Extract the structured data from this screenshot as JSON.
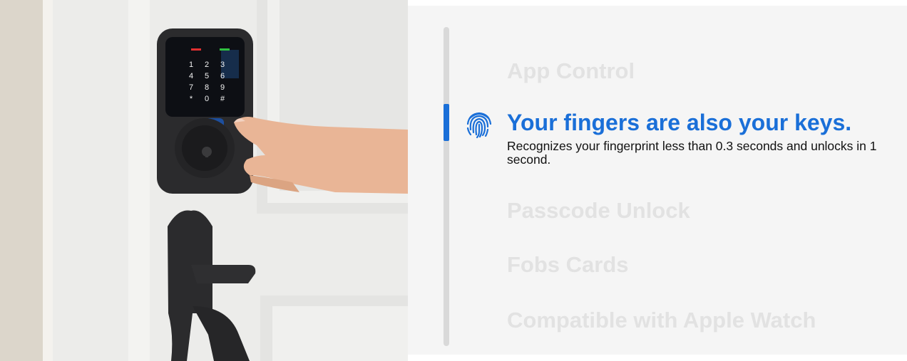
{
  "photo": {
    "keypad_keys": [
      "1",
      "2",
      "3",
      "4",
      "5",
      "6",
      "7",
      "8",
      "9",
      "*",
      "0",
      "#"
    ],
    "colors": {
      "wall": "#e9e6e0",
      "door": "#ececea",
      "lock": "#2b2b2d",
      "skin": "#e9b596"
    }
  },
  "features": {
    "items": [
      {
        "label": "App Control",
        "state": "inactive"
      },
      {
        "label": "Your fingers are also your keys.",
        "state": "active",
        "description": "Recognizes your fingerprint less than 0.3 seconds and unlocks in 1 second."
      },
      {
        "label": "Passcode Unlock",
        "state": "inactive"
      },
      {
        "label": "Fobs Cards",
        "state": "inactive"
      },
      {
        "label": "Compatible with Apple Watch",
        "state": "inactive"
      }
    ],
    "active_icon": "fingerprint-icon",
    "colors": {
      "active": "#1a6fd8",
      "inactive": "#e2e2e2",
      "panel": "#f5f5f5",
      "rail": "#d9d9d9"
    }
  }
}
